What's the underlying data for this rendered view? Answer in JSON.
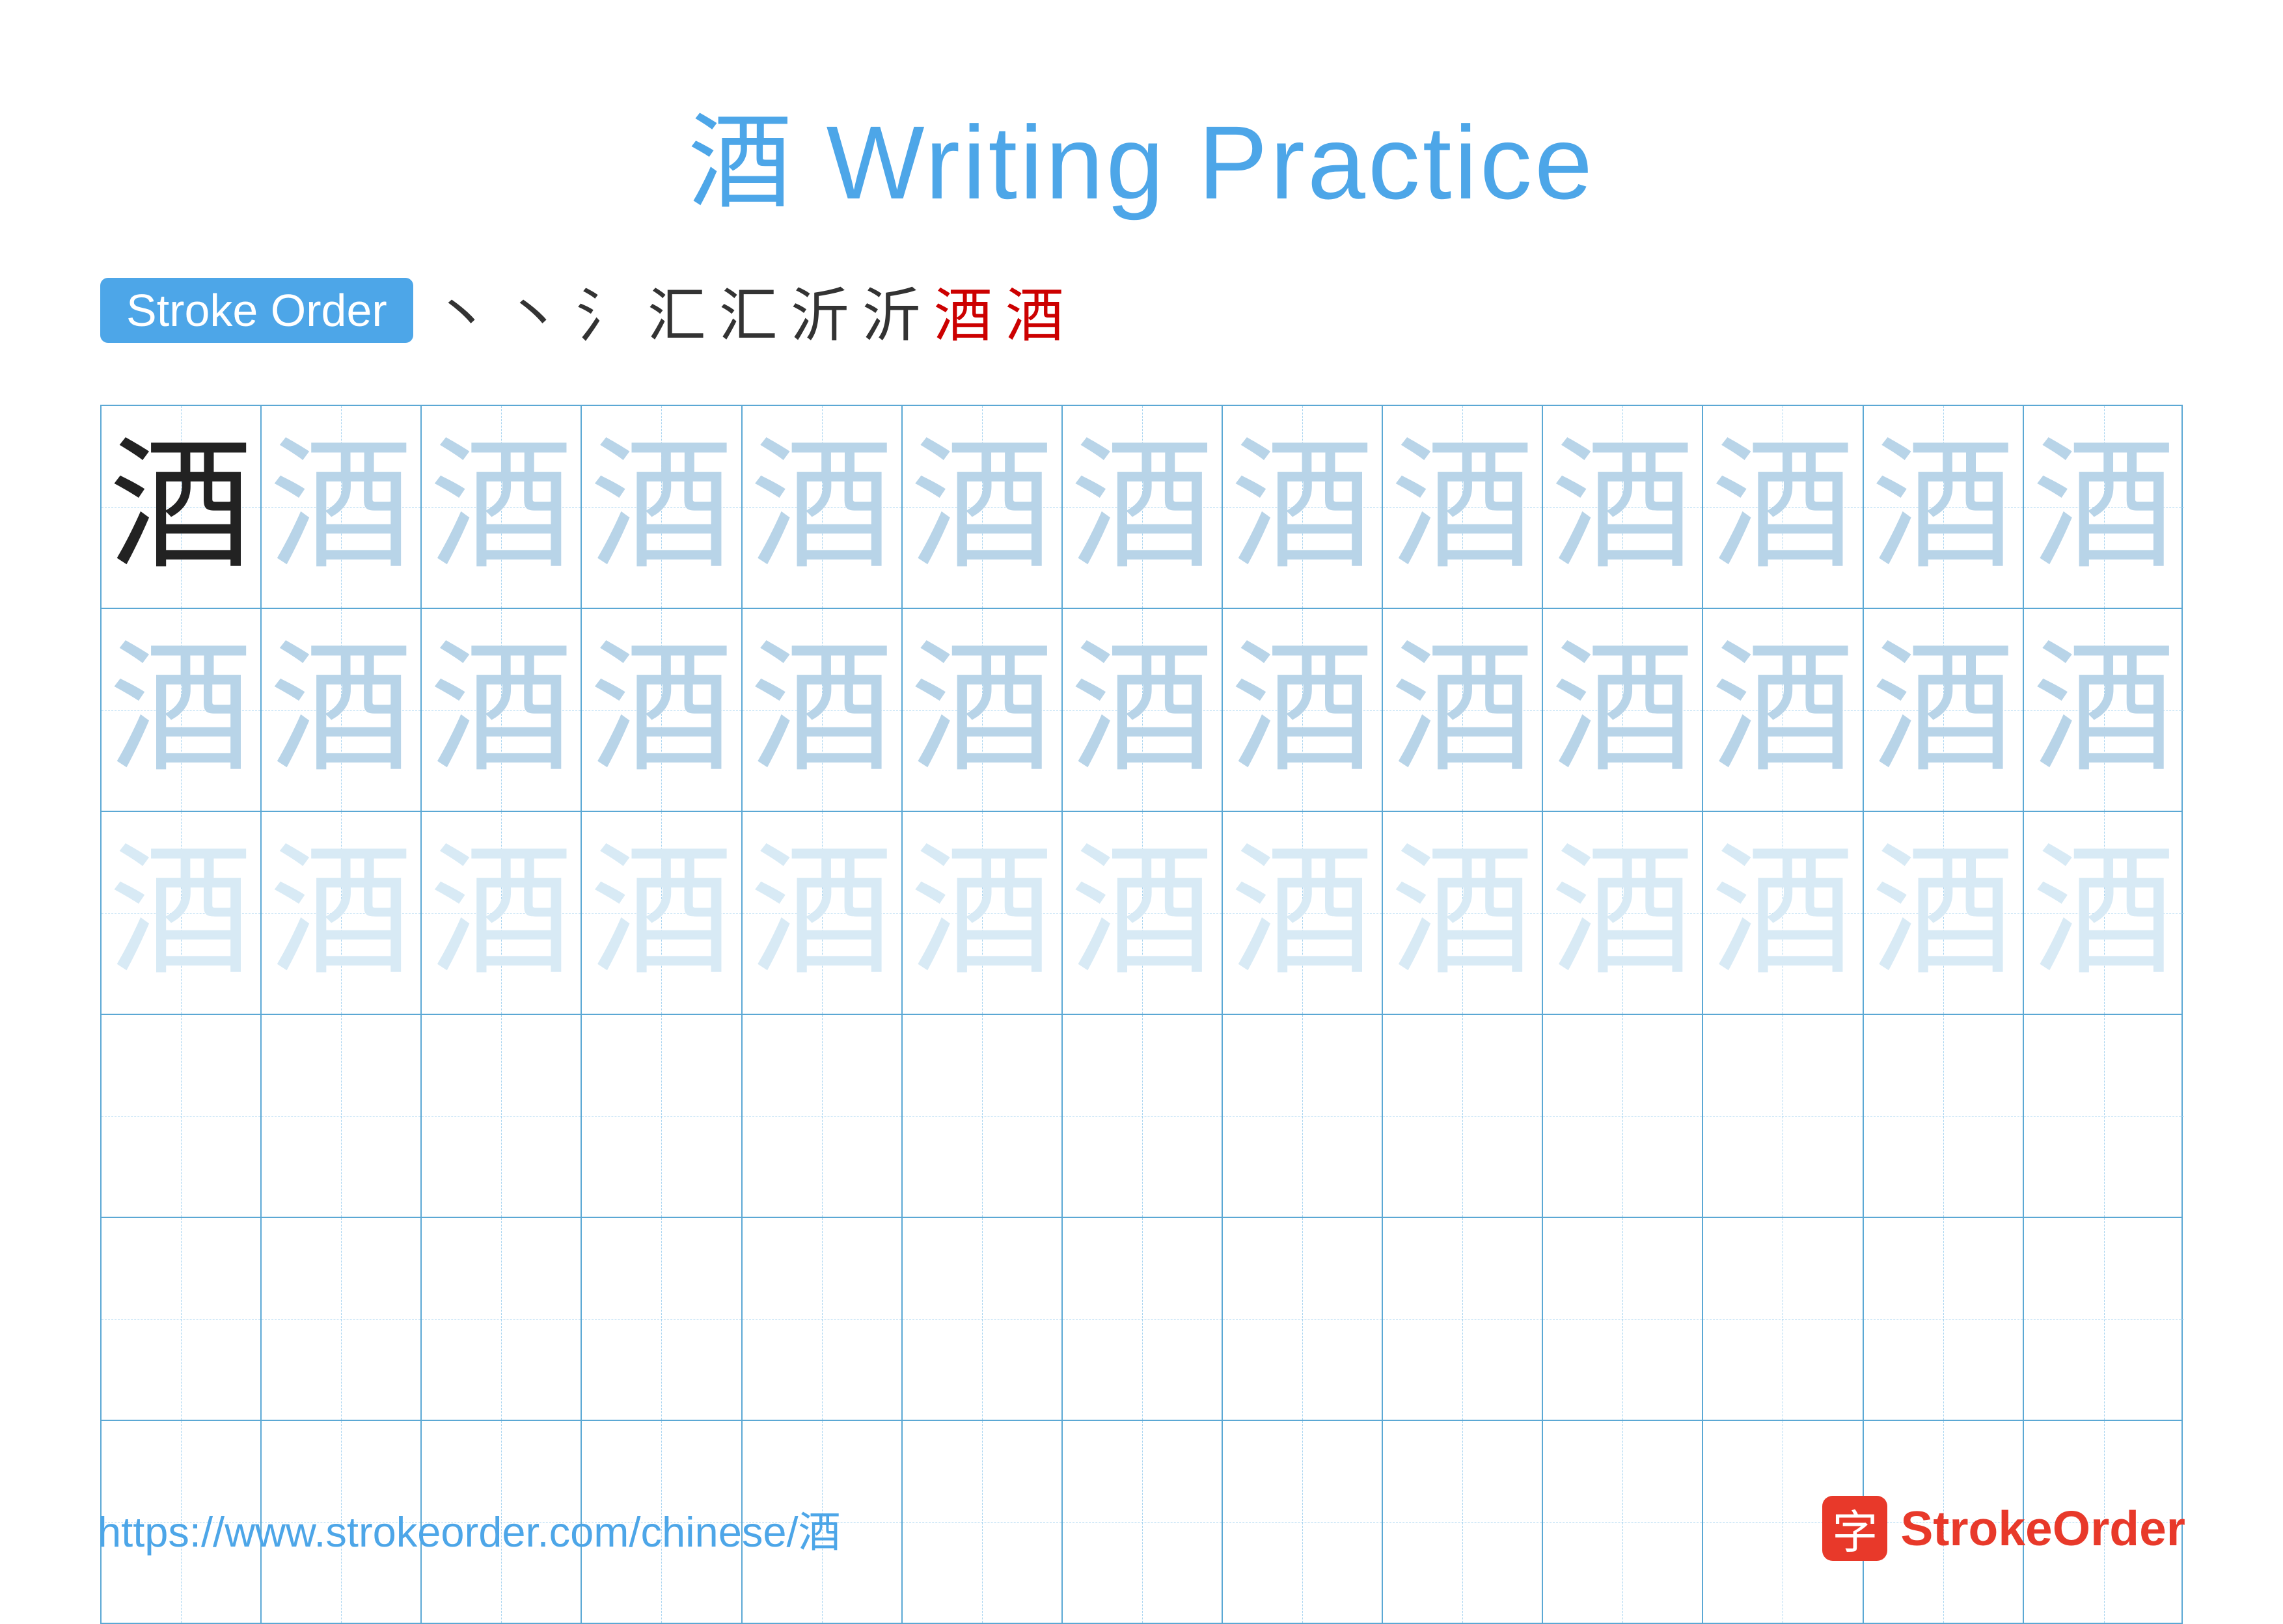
{
  "title": "酒 Writing Practice",
  "stroke_order": {
    "badge_label": "Stroke Order",
    "strokes": [
      "丶",
      "丶",
      "氵",
      "汇",
      "汇",
      "沂",
      "沂",
      "酒",
      "酒"
    ]
  },
  "grid": {
    "rows": 6,
    "cols": 13,
    "character": "酒",
    "row_configs": [
      {
        "type": "dark-then-medium",
        "dark_count": 1,
        "medium_count": 12
      },
      {
        "type": "medium",
        "count": 13
      },
      {
        "type": "light",
        "count": 13
      },
      {
        "type": "empty"
      },
      {
        "type": "empty"
      },
      {
        "type": "empty"
      }
    ]
  },
  "footer": {
    "url": "https://www.strokeorder.com/chinese/酒",
    "logo_char": "字",
    "logo_name": "StrokeOrder"
  }
}
